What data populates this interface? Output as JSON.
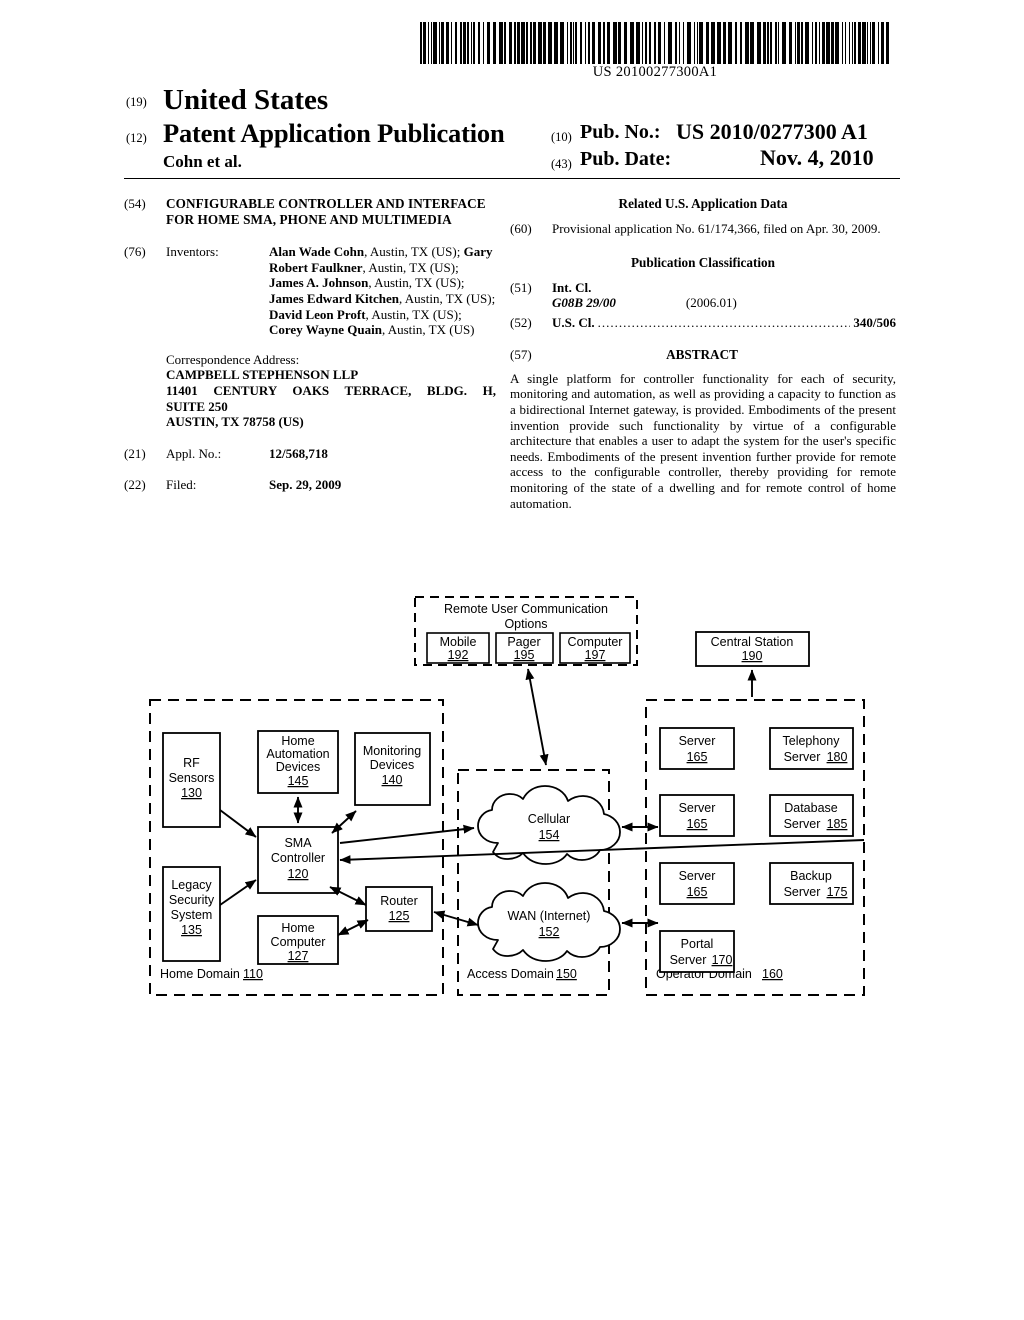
{
  "barcode": {
    "number": "US 20100277300A1"
  },
  "masthead": {
    "code_19": "(19)",
    "country": "United States",
    "code_12": "(12)",
    "doc_type": "Patent Application Publication",
    "applicant": "Cohn et al.",
    "code_10": "(10)",
    "pub_no_label": "Pub. No.:",
    "pub_no_value": "US 2010/0277300 A1",
    "code_43": "(43)",
    "pub_date_label": "Pub. Date:",
    "pub_date_value": "Nov. 4, 2010"
  },
  "left_column": {
    "title_code": "(54)",
    "title": "CONFIGURABLE CONTROLLER AND INTERFACE FOR HOME SMA, PHONE AND MULTIMEDIA",
    "inventors_code": "(76)",
    "inventors_label": "Inventors:",
    "inventors_text": "Alan Wade Cohn, Austin, TX (US); Gary Robert Faulkner, Austin, TX (US); James A. Johnson, Austin, TX (US); James Edward Kitchen, Austin, TX (US); David Leon Proft, Austin, TX (US); Corey Wayne Quain, Austin, TX (US)",
    "correspondence_label": "Correspondence Address:",
    "correspondence_lines": [
      "CAMPBELL STEPHENSON LLP",
      "11401 CENTURY OAKS TERRACE, BLDG. H,",
      "SUITE 250",
      "AUSTIN, TX 78758 (US)"
    ],
    "appl_no_code": "(21)",
    "appl_no_label": "Appl. No.:",
    "appl_no_value": "12/568,718",
    "filed_code": "(22)",
    "filed_label": "Filed:",
    "filed_value": "Sep. 29, 2009"
  },
  "right_column": {
    "related_heading": "Related U.S. Application Data",
    "related_code": "(60)",
    "related_text": "Provisional application No. 61/174,366, filed on Apr. 30, 2009.",
    "classification_heading": "Publication Classification",
    "int_cl_code": "(51)",
    "int_cl_label": "Int. Cl.",
    "int_cl_value": "G08B 29/00",
    "int_cl_edition": "(2006.01)",
    "us_cl_code": "(52)",
    "us_cl_label": "U.S. Cl.",
    "us_cl_value": "340/506",
    "abstract_code": "(57)",
    "abstract_heading": "ABSTRACT",
    "abstract_text": "A single platform for controller functionality for each of security, monitoring and automation, as well as providing a capacity to function as a bidirectional Internet gateway, is provided. Embodiments of the present invention provide such functionality by virtue of a configurable architecture that enables a user to adapt the system for the user's specific needs. Embodiments of the present invention further provide for remote access to the configurable controller, thereby providing for remote monitoring of the state of a dwelling and for remote control of home automation."
  },
  "figure": {
    "remote_group": {
      "title_line1": "Remote User Communication",
      "title_line2": "Options",
      "boxes": [
        {
          "label": "Mobile",
          "ref": "192"
        },
        {
          "label": "Pager",
          "ref": "195"
        },
        {
          "label": "Computer",
          "ref": "197"
        }
      ]
    },
    "central_station": {
      "label": "Central Station",
      "ref": "190"
    },
    "home_domain": {
      "caption": "Home Domain",
      "caption_ref": "110",
      "boxes": [
        {
          "label_lines": [
            "RF",
            "Sensors"
          ],
          "ref": "130"
        },
        {
          "label_lines": [
            "Home",
            "Automation",
            "Devices"
          ],
          "ref": "145"
        },
        {
          "label_lines": [
            "Monitoring",
            "Devices"
          ],
          "ref": "140"
        },
        {
          "label_lines": [
            "SMA",
            "Controller"
          ],
          "ref": "120"
        },
        {
          "label_lines": [
            "Legacy",
            "Security",
            "System"
          ],
          "ref": "135"
        },
        {
          "label_lines": [
            "Home",
            "Computer"
          ],
          "ref": "127"
        },
        {
          "label_lines": [
            "Router"
          ],
          "ref": "125"
        }
      ]
    },
    "access_domain": {
      "caption": "Access Domain",
      "caption_ref": "150",
      "clouds": [
        {
          "label": "Cellular",
          "ref": "154"
        },
        {
          "label": "WAN (Internet)",
          "ref": "152"
        }
      ]
    },
    "operator_domain": {
      "caption": "Operator Domain",
      "caption_ref": "160",
      "boxes": [
        {
          "label": "Server",
          "ref": "165",
          "inline": false
        },
        {
          "label": "Server",
          "ref": "165",
          "inline": false
        },
        {
          "label": "Server",
          "ref": "165",
          "inline": false
        },
        {
          "label_lines": [
            "Portal",
            "Server"
          ],
          "ref": "170",
          "inline": true
        },
        {
          "label_lines": [
            "Telephony",
            "Server"
          ],
          "ref": "180",
          "inline": true
        },
        {
          "label_lines": [
            "Database",
            "Server"
          ],
          "ref": "185",
          "inline": true
        },
        {
          "label_lines": [
            "Backup",
            "Server"
          ],
          "ref": "175",
          "inline": true
        }
      ]
    }
  }
}
